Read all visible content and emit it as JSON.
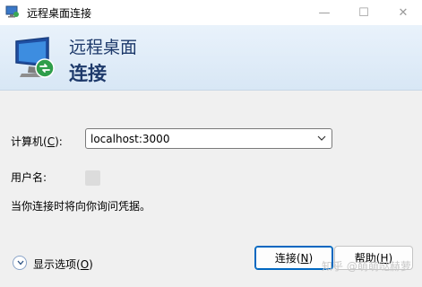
{
  "window": {
    "title": "远程桌面连接",
    "controls": {
      "minimize": "—",
      "maximize": "☐",
      "close": "✕"
    }
  },
  "header": {
    "line1": "远程桌面",
    "line2": "连接"
  },
  "form": {
    "computer": {
      "label_prefix": "计算机(",
      "label_key": "C",
      "label_suffix": "):",
      "value": "localhost:3000"
    },
    "username": {
      "label": "用户名:"
    },
    "note": "当你连接时将向你询问凭据。"
  },
  "footer": {
    "options": {
      "label_prefix": "显示选项(",
      "label_key": "O",
      "label_suffix": ")"
    },
    "connect": {
      "label_prefix": "连接(",
      "label_key": "N",
      "label_suffix": ")"
    },
    "help": {
      "label_prefix": "帮助(",
      "label_key": "H",
      "label_suffix": ")"
    }
  },
  "watermark": "知乎 @萌萌哒赫萝",
  "colors": {
    "accent": "#0067c0",
    "header_text": "#1e3a6b",
    "header_bg": "#dfeaf6"
  },
  "icons": {
    "app": "remote-desktop-icon",
    "header": "remote-desktop-monitor-icon",
    "combo": "chevron-down-icon",
    "options": "chevron-down-circle-icon"
  }
}
